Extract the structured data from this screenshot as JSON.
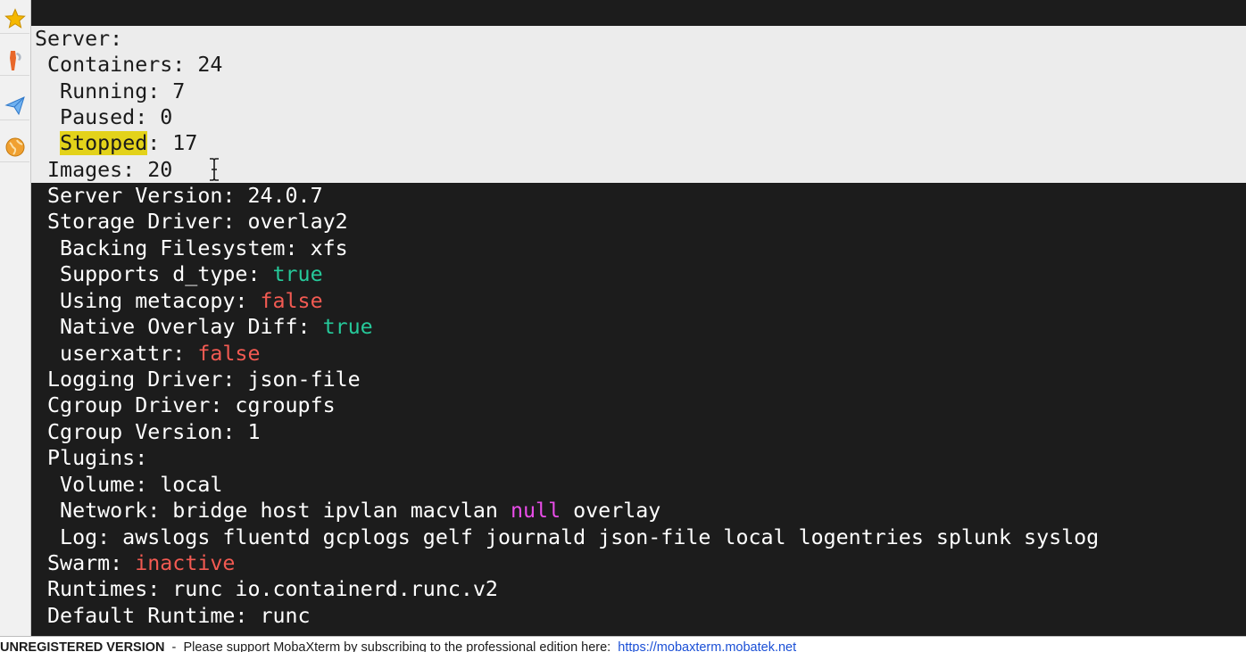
{
  "sidebar": {
    "buttons": [
      {
        "icon": "star-icon",
        "color": "#f5b800"
      },
      {
        "icon": "tools-icon",
        "color": "#e8672a"
      },
      {
        "icon": "paper-plane-icon",
        "color": "#3a8ee6"
      },
      {
        "icon": "globe-icon",
        "color": "#f0a030"
      }
    ]
  },
  "terminal": {
    "selected_lines": {
      "server": "Server:",
      "containers": " Containers: 24",
      "running": "  Running: 7",
      "paused": "  Paused: 0",
      "stopped_word": "Stopped",
      "stopped_rest": ": 17",
      "images": " Images: 20"
    },
    "lines": {
      "server_version": " Server Version: 24.0.7",
      "storage_driver": " Storage Driver: overlay2",
      "backing_fs": "  Backing Filesystem: xfs",
      "d_type_key": "  Supports d_type: ",
      "d_type_val": "true",
      "metacopy_key": "  Using metacopy: ",
      "metacopy_val": "false",
      "native_key": "  Native Overlay Diff: ",
      "native_val": "true",
      "userxattr_key": "  userxattr: ",
      "userxattr_val": "false",
      "logging_driver": " Logging Driver: json-file",
      "cgroup_driver": " Cgroup Driver: cgroupfs",
      "cgroup_version": " Cgroup Version: 1",
      "plugins": " Plugins:",
      "volume": "  Volume: local",
      "network_a": "  Network: bridge host ipvlan macvlan ",
      "network_null": "null",
      "network_b": " overlay",
      "log": "  Log: awslogs fluentd gcplogs gelf journald json-file local logentries splunk syslog",
      "swarm_key": " Swarm: ",
      "swarm_val": "inactive",
      "runtimes": " Runtimes: runc io.containerd.runc.v2",
      "default_runtime": " Default Runtime: runc"
    },
    "colors": {
      "background": "#1c1c1c",
      "selection": "#ececec",
      "true": "#26c99a",
      "false": "#f25a52",
      "null": "#e84de8",
      "search_highlight": "#e3d21a"
    }
  },
  "statusbar": {
    "unregistered": "UNREGISTERED VERSION",
    "message": "  -  Please support MobaXterm by subscribing to the professional edition here:  ",
    "link": "https://mobaxterm.mobatek.net"
  }
}
